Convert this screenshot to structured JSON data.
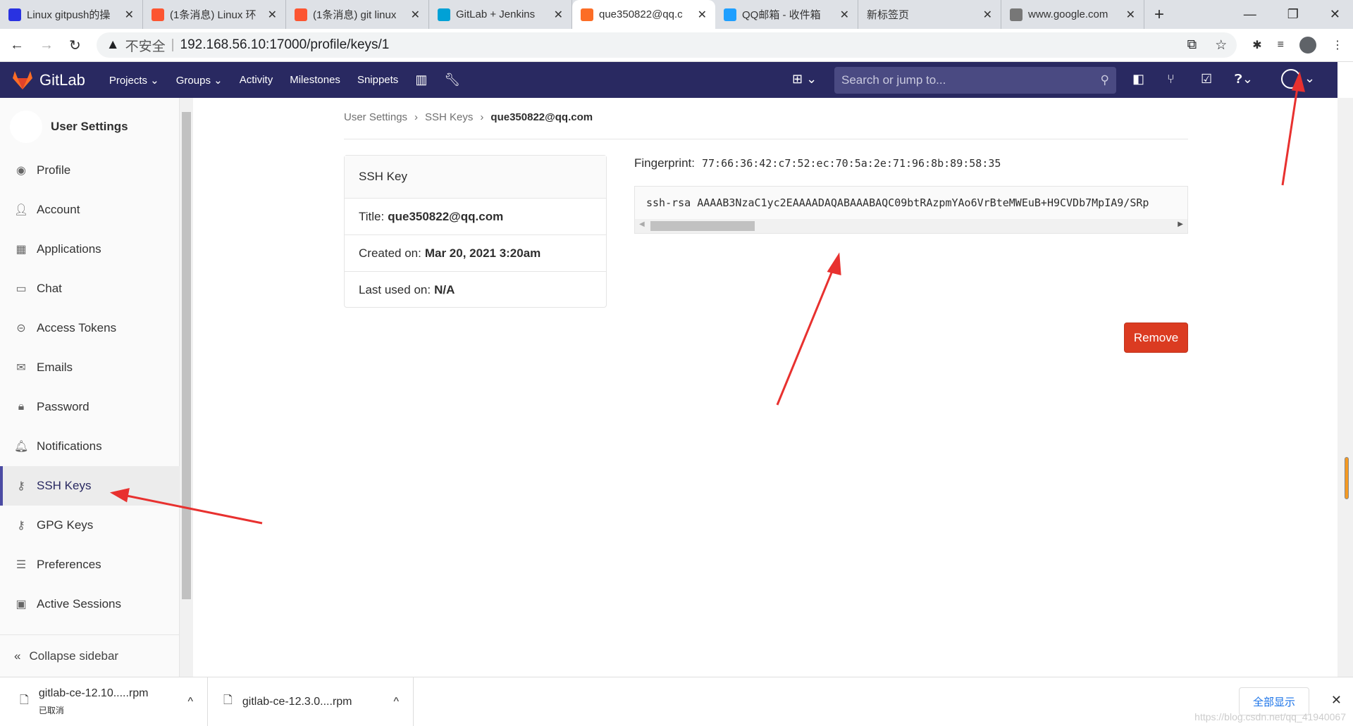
{
  "browser": {
    "tabs": [
      {
        "title": "Linux gitpush的操",
        "icon": "baidu-paw-icon",
        "color": "#2932e1"
      },
      {
        "title": "(1条消息) Linux 环",
        "icon": "csdn-icon",
        "color": "#fc5531"
      },
      {
        "title": "(1条消息) git linux",
        "icon": "csdn-icon",
        "color": "#fc5531"
      },
      {
        "title": "GitLab + Jenkins",
        "icon": "bilibili-icon",
        "color": "#00a1d6"
      },
      {
        "title": "que350822@qq.c",
        "icon": "gitlab-icon",
        "color": "#fc6d26",
        "active": true
      },
      {
        "title": "QQ邮箱 - 收件箱",
        "icon": "qqmail-icon",
        "color": "#1e9fff"
      },
      {
        "title": "新标签页",
        "icon": "",
        "color": ""
      },
      {
        "title": "www.google.com",
        "icon": "globe-icon",
        "color": "#777"
      }
    ],
    "new_tab": "+",
    "security": "不安全",
    "url": "192.168.56.10:17000/profile/keys/1"
  },
  "nav": {
    "brand": "GitLab",
    "items": [
      "Projects",
      "Groups",
      "Activity",
      "Milestones",
      "Snippets"
    ],
    "search_placeholder": "Search or jump to...",
    "color": "#292961"
  },
  "sidebar": {
    "title": "User Settings",
    "items": [
      {
        "label": "Profile",
        "icon": "profile-icon"
      },
      {
        "label": "Account",
        "icon": "account-icon"
      },
      {
        "label": "Applications",
        "icon": "applications-icon"
      },
      {
        "label": "Chat",
        "icon": "chat-icon"
      },
      {
        "label": "Access Tokens",
        "icon": "token-icon"
      },
      {
        "label": "Emails",
        "icon": "mail-icon"
      },
      {
        "label": "Password",
        "icon": "lock-icon"
      },
      {
        "label": "Notifications",
        "icon": "bell-icon"
      },
      {
        "label": "SSH Keys",
        "icon": "key-icon",
        "active": true
      },
      {
        "label": "GPG Keys",
        "icon": "key-icon"
      },
      {
        "label": "Preferences",
        "icon": "sliders-icon"
      },
      {
        "label": "Active Sessions",
        "icon": "monitor-icon"
      }
    ],
    "collapse": "Collapse sidebar"
  },
  "breadcrumb": [
    "User Settings",
    "SSH Keys",
    "que350822@qq.com"
  ],
  "card": {
    "header": "SSH Key",
    "title_label": "Title:",
    "title_value": "que350822@qq.com",
    "created_label": "Created on:",
    "created_value": "Mar 20, 2021 3:20am",
    "used_label": "Last used on:",
    "used_value": "N/A"
  },
  "fingerprint": {
    "label": "Fingerprint:",
    "value": "77:66:36:42:c7:52:ec:70:5a:2e:71:96:8b:89:58:35"
  },
  "key": "ssh-rsa AAAAB3NzaC1yc2EAAAADAQABAAABAQC09btRAzpmYAo6VrBteMWEuB+H9CVDb7MpIA9/SRp",
  "remove_label": "Remove",
  "remove_color": "#db3b21",
  "downloads": [
    {
      "name": "gitlab-ce-12.10.....rpm",
      "status": "已取消"
    },
    {
      "name": "gitlab-ce-12.3.0....rpm"
    }
  ],
  "show_all": "全部显示",
  "watermark": "https://blog.csdn.net/qq_41940067"
}
